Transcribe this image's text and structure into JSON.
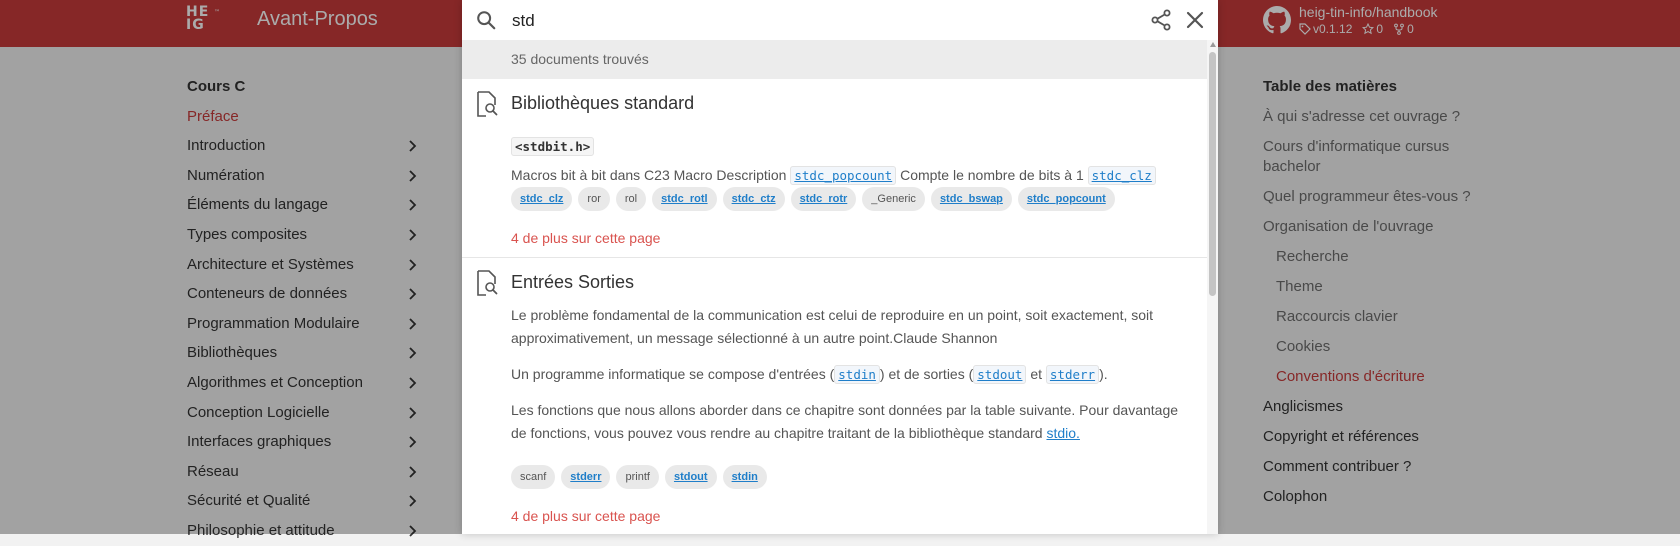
{
  "header": {
    "logo_text": "HE IG",
    "title": "Avant-Propos",
    "repo": {
      "name": "heig-tin-info/handbook",
      "version": "v0.1.12",
      "stars": "0",
      "forks": "0"
    }
  },
  "sidebar": {
    "items": [
      {
        "label": "Cours C",
        "kind": "heading"
      },
      {
        "label": "Préface",
        "kind": "active"
      },
      {
        "label": "Introduction",
        "kind": "expand"
      },
      {
        "label": "Numération",
        "kind": "expand"
      },
      {
        "label": "Éléments du langage",
        "kind": "expand"
      },
      {
        "label": "Types composites",
        "kind": "expand"
      },
      {
        "label": "Architecture et Systèmes",
        "kind": "expand"
      },
      {
        "label": "Conteneurs de données",
        "kind": "expand"
      },
      {
        "label": "Programmation Modulaire",
        "kind": "expand"
      },
      {
        "label": "Bibliothèques",
        "kind": "expand"
      },
      {
        "label": "Algorithmes et Conception",
        "kind": "expand"
      },
      {
        "label": "Conception Logicielle",
        "kind": "expand"
      },
      {
        "label": "Interfaces graphiques",
        "kind": "expand"
      },
      {
        "label": "Réseau",
        "kind": "expand"
      },
      {
        "label": "Sécurité et Qualité",
        "kind": "expand"
      },
      {
        "label": "Philosophie et attitude",
        "kind": "expand"
      }
    ]
  },
  "toc": {
    "title": "Table des matières",
    "items": [
      {
        "label": "À qui s'adresse cet ouvrage ?"
      },
      {
        "label": "Cours d'informatique cursus bachelor"
      },
      {
        "label": "Quel programmeur êtes-vous ?"
      },
      {
        "label": "Organisation de l'ouvrage"
      },
      {
        "label": "Recherche",
        "sub": true
      },
      {
        "label": "Theme",
        "sub": true
      },
      {
        "label": "Raccourcis clavier",
        "sub": true
      },
      {
        "label": "Cookies",
        "sub": true
      },
      {
        "label": "Conventions d'écriture",
        "sub": true,
        "active": true
      },
      {
        "label": "Anglicismes",
        "strong": true
      },
      {
        "label": "Copyright et références",
        "strong": true
      },
      {
        "label": "Comment contribuer ?",
        "strong": true
      },
      {
        "label": "Colophon",
        "strong": true
      }
    ]
  },
  "search": {
    "query": "std",
    "count_text": "35 documents trouvés",
    "results": [
      {
        "title": "Bibliothèques standard",
        "heading_code": "<stdbit.h>",
        "snippet_a": "Macros bit à bit dans C23 Macro Description ",
        "snippet_code_1": "stdc_popcount",
        "snippet_b": " Compte le nombre de bits à 1 ",
        "snippet_code_2": "stdc_clz",
        "chips": [
          {
            "label": "stdc_clz",
            "link": true
          },
          {
            "label": "ror",
            "link": false
          },
          {
            "label": "rol",
            "link": false
          },
          {
            "label": "stdc_rotl",
            "link": true
          },
          {
            "label": "stdc_ctz",
            "link": true
          },
          {
            "label": "stdc_rotr",
            "link": true
          },
          {
            "label": "_Generic",
            "link": false
          },
          {
            "label": "stdc_bswap",
            "link": true
          },
          {
            "label": "stdc_popcount",
            "link": true
          }
        ],
        "more": "4 de plus sur cette page"
      },
      {
        "title": "Entrées Sorties",
        "para1": "Le problème fondamental de la communication est celui de reproduire en un point, soit exactement, soit approximativement, un message sélectionné à un autre point.Claude Shannon",
        "para2_a": "Un programme informatique se compose d'entrées (",
        "para2_code_1": "stdin",
        "para2_b": ") et de sorties (",
        "para2_code_2": "stdout",
        "para2_c": " et ",
        "para2_code_3": "stderr",
        "para2_d": ").",
        "para3_a": "Les fonctions que nous allons aborder dans ce chapitre sont données par la table suivante. Pour davantage de fonctions, vous pouvez vous rendre au chapitre traitant de la bibliothèque standard ",
        "para3_link": "stdio.",
        "chips": [
          {
            "label": "scanf",
            "link": false
          },
          {
            "label": "stderr",
            "link": true
          },
          {
            "label": "printf",
            "link": false
          },
          {
            "label": "stdout",
            "link": true
          },
          {
            "label": "stdin",
            "link": true
          }
        ],
        "more": "4 de plus sur cette page"
      }
    ]
  }
}
